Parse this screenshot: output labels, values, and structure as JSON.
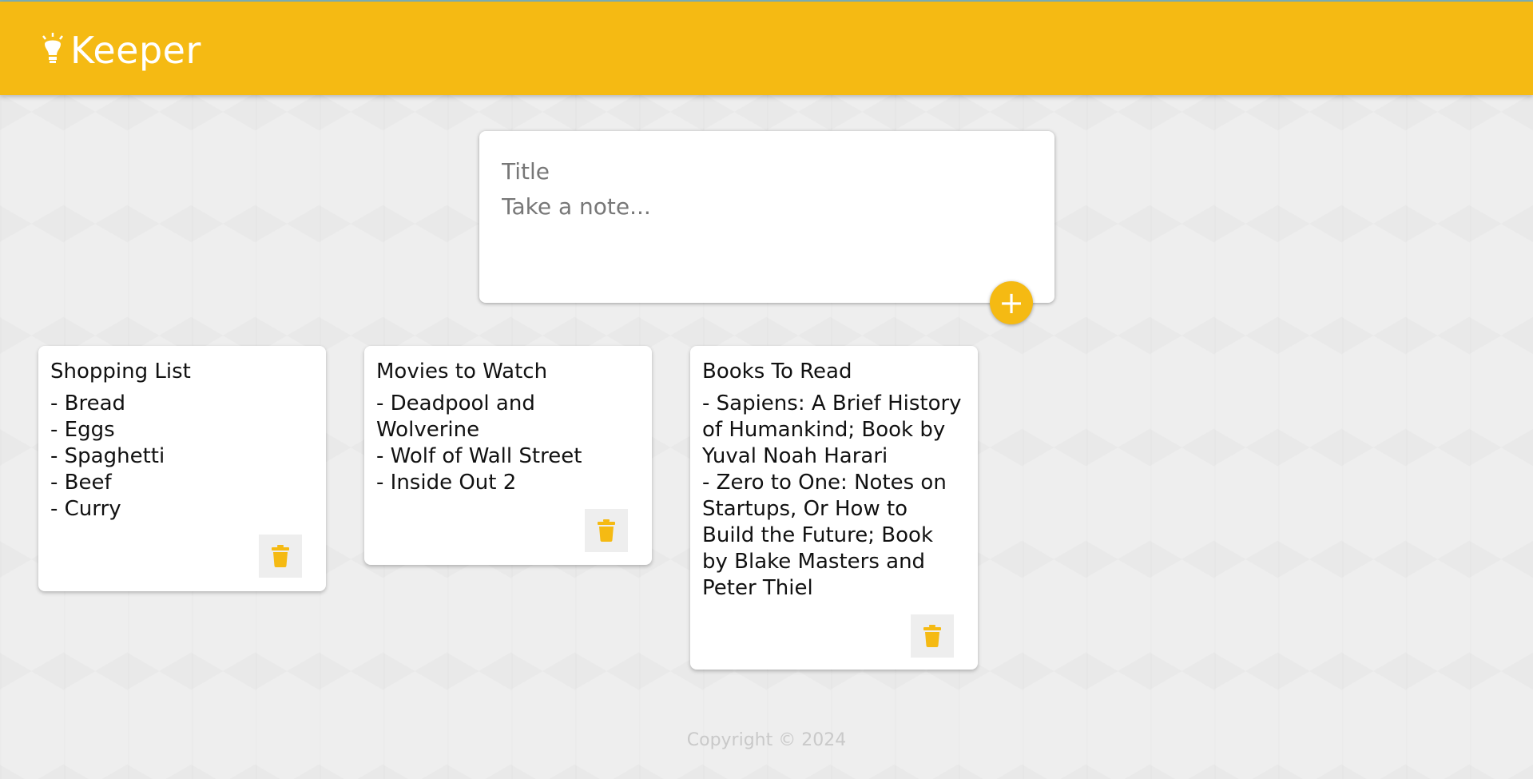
{
  "app": {
    "name": "Keeper",
    "logo_icon": "lightbulb-icon",
    "accent_color": "#f5ba13"
  },
  "create_note": {
    "title_placeholder": "Title",
    "content_placeholder": "Take a note...",
    "add_button_label": "+",
    "add_icon": "plus-icon"
  },
  "notes": [
    {
      "title": "Shopping List",
      "lines": [
        "- Bread",
        "- Eggs",
        "- Spaghetti",
        "- Beef",
        "- Curry"
      ],
      "delete_icon": "trash-icon"
    },
    {
      "title": "Movies to Watch",
      "lines": [
        "- Deadpool and",
        "Wolverine",
        "- Wolf of Wall Street",
        "- Inside Out 2"
      ],
      "delete_icon": "trash-icon"
    },
    {
      "title": "Books To Read",
      "lines": [
        "- Sapiens: A Brief History",
        "of Humankind; Book by",
        "Yuval Noah Harari",
        "- Zero to One: Notes on",
        "Startups, Or How to",
        "Build the Future; Book",
        "by Blake Masters and",
        "Peter Thiel"
      ],
      "delete_icon": "trash-icon"
    }
  ],
  "footer": {
    "copyright": "Copyright © 2024"
  }
}
